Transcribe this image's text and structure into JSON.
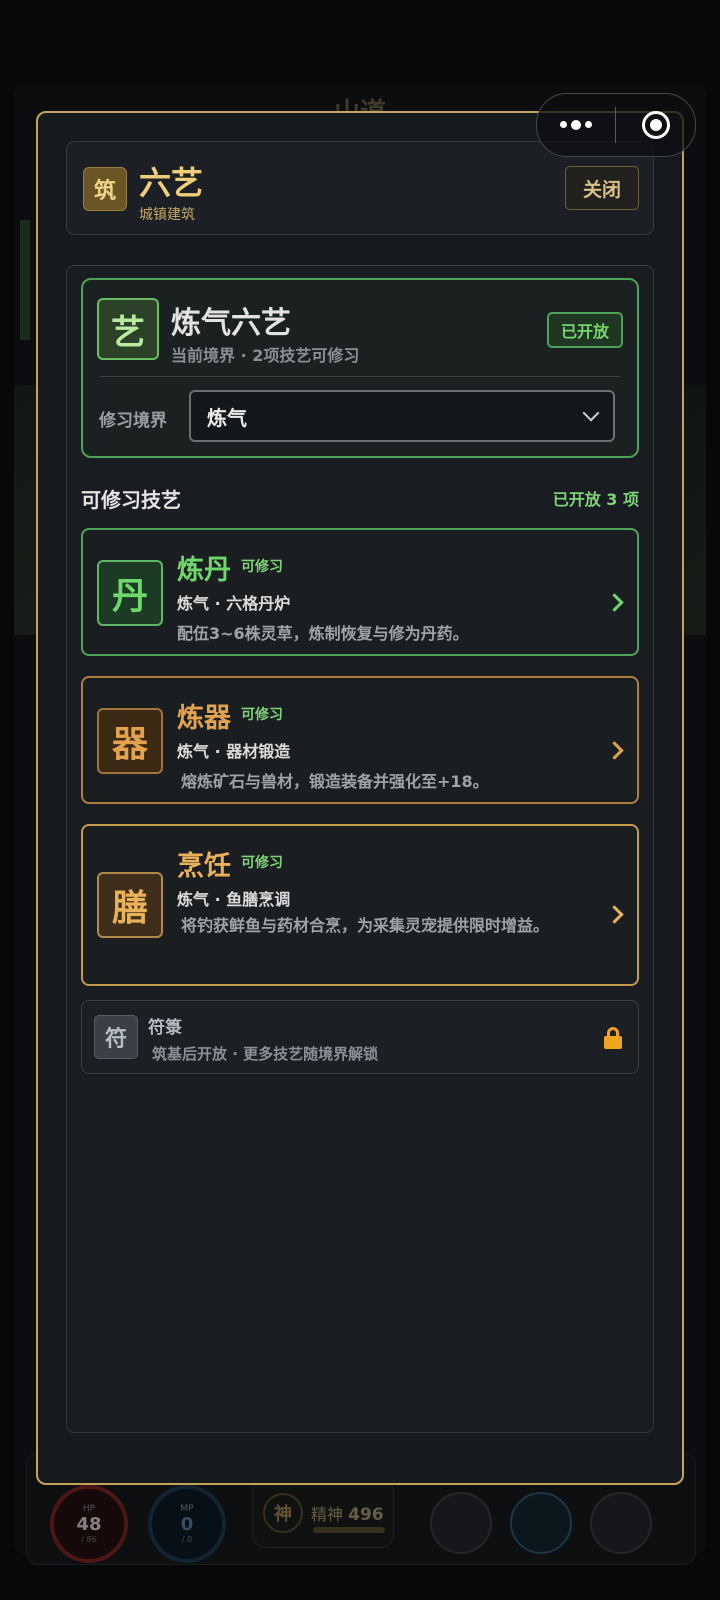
{
  "background": {
    "title": "山道",
    "hud": {
      "hp": {
        "label": "HP",
        "value": "48",
        "sub": "/ 86"
      },
      "mp": {
        "label": "MP",
        "value": "0",
        "sub": "/ 0"
      },
      "spirit": {
        "icon_text": "神",
        "label": "精神",
        "value": "496"
      }
    }
  },
  "capsule": {
    "more_icon": "more-dots-icon",
    "close_icon": "target-circle-icon"
  },
  "modal": {
    "header": {
      "icon_text": "筑",
      "title": "六艺",
      "subtitle": "城镇建筑",
      "close_label": "关闭"
    },
    "realm_card": {
      "icon_text": "艺",
      "title": "炼气六艺",
      "subtitle": "当前境界 · 2项技艺可修习",
      "badge": "已开放",
      "select_label": "修习境界",
      "select_value": "炼气"
    },
    "skills_section": {
      "title": "可修习技艺",
      "count": "已开放 3 项",
      "items": [
        {
          "icon_text": "丹",
          "name": "炼丹",
          "tag": "可修习",
          "line1": "炼气 · 六格丹炉",
          "desc": "配伍3~6株灵草，炼制恢复与修为丹药。"
        },
        {
          "icon_text": "器",
          "name": "炼器",
          "tag": "可修习",
          "line1": "炼气 · 器材锻造",
          "desc": "熔炼矿石与兽材，锻造装备并强化至+18。"
        },
        {
          "icon_text": "膳",
          "name": "烹饪",
          "tag": "可修习",
          "line1": "炼气 · 鱼膳烹调",
          "desc": "将钓获鲜鱼与药材合烹，为采集灵宠提供限时增益。"
        }
      ]
    },
    "locked": {
      "icon_text": "符",
      "name": "符箓",
      "desc": "筑基后开放 · 更多技艺随境界解锁"
    }
  },
  "colors": {
    "gold": "#c4a35c",
    "green": "#4fa25a",
    "orange": "#e3a24d",
    "lock": "#f0a522"
  }
}
